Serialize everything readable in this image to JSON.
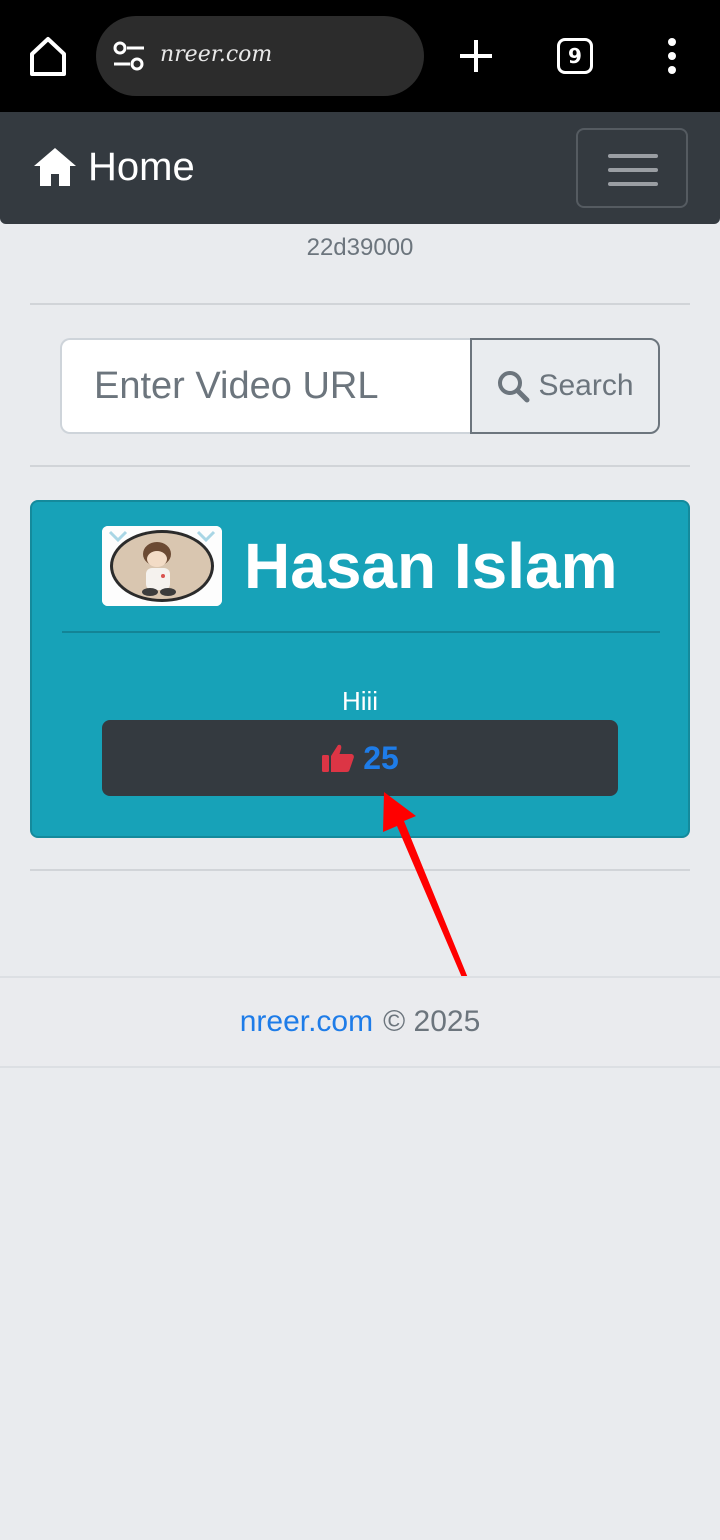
{
  "browser": {
    "url": "nreer.com",
    "tab_count": "9"
  },
  "navbar": {
    "brand": "Home"
  },
  "visitor_id": "22d39000",
  "search": {
    "placeholder": "Enter Video URL",
    "button_label": "Search"
  },
  "post": {
    "author": "Hasan Islam",
    "message": "Hiii",
    "likes": "25"
  },
  "footer": {
    "site_link": "nreer.com",
    "copyright": "© 2025"
  },
  "colors": {
    "navbar": "#343a40",
    "card": "#17a2b8",
    "like_icon": "#dc3545",
    "link": "#1e7ce8",
    "annotation_arrow": "#ff0000"
  }
}
